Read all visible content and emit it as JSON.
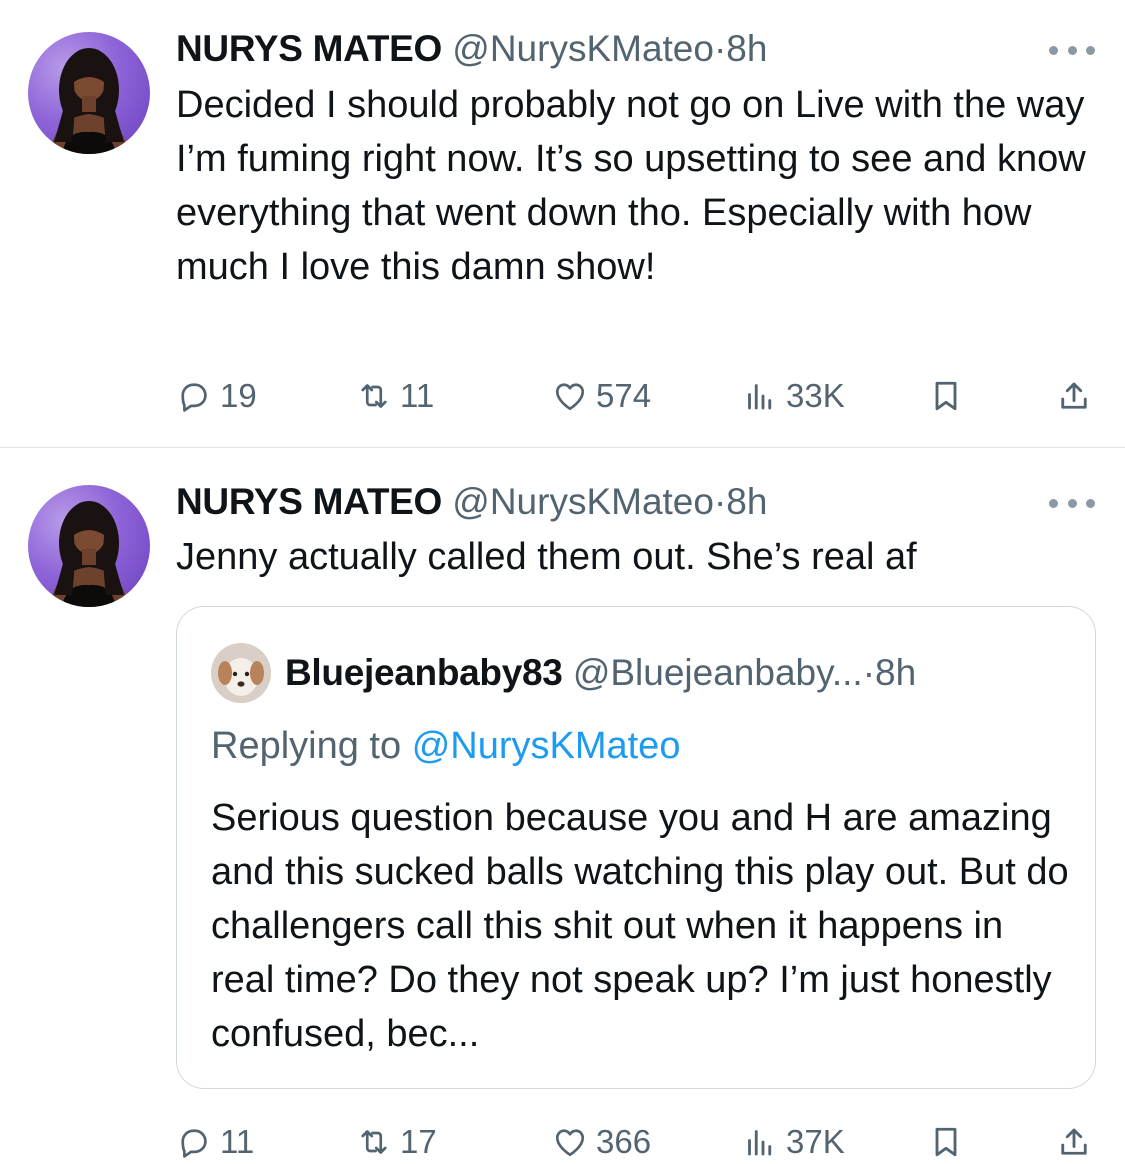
{
  "tweets": [
    {
      "author": {
        "name": "NURYS MATEO",
        "handle": "@NurysKMateo",
        "time": "8h"
      },
      "text": "Decided I should probably not go on Live with the way I’m fuming right now. It’s so upsetting to see and know everything that went down tho. Especially with how much I love this damn show!",
      "stats": {
        "replies": "19",
        "retweets": "11",
        "likes": "574",
        "views": "33K"
      }
    },
    {
      "author": {
        "name": "NURYS MATEO",
        "handle": "@NurysKMateo",
        "time": "8h"
      },
      "text": "Jenny actually called them out. She’s real af",
      "quote": {
        "author": {
          "name": "Bluejeanbaby83",
          "handle": "@Bluejeanbaby...",
          "time": "8h"
        },
        "replying_prefix": "Replying to",
        "replying_to": "@NurysKMateo",
        "text": "Serious question because you and H are amazing and this sucked balls watching this play out. But do challengers call this shit out when it happens in real time? Do they not speak up? I’m just honestly confused, bec..."
      },
      "stats": {
        "replies": "11",
        "retweets": "17",
        "likes": "366",
        "views": "37K"
      }
    }
  ],
  "separator": "·",
  "colors": {
    "text": "#0f1419",
    "secondary": "#536471",
    "link": "#1d9bf0",
    "border": "#cfd9de",
    "avatar_bg": "#8e64d8"
  },
  "icons": [
    "reply-icon",
    "retweet-icon",
    "like-icon",
    "views-icon",
    "bookmark-icon",
    "share-icon",
    "more-icon"
  ]
}
